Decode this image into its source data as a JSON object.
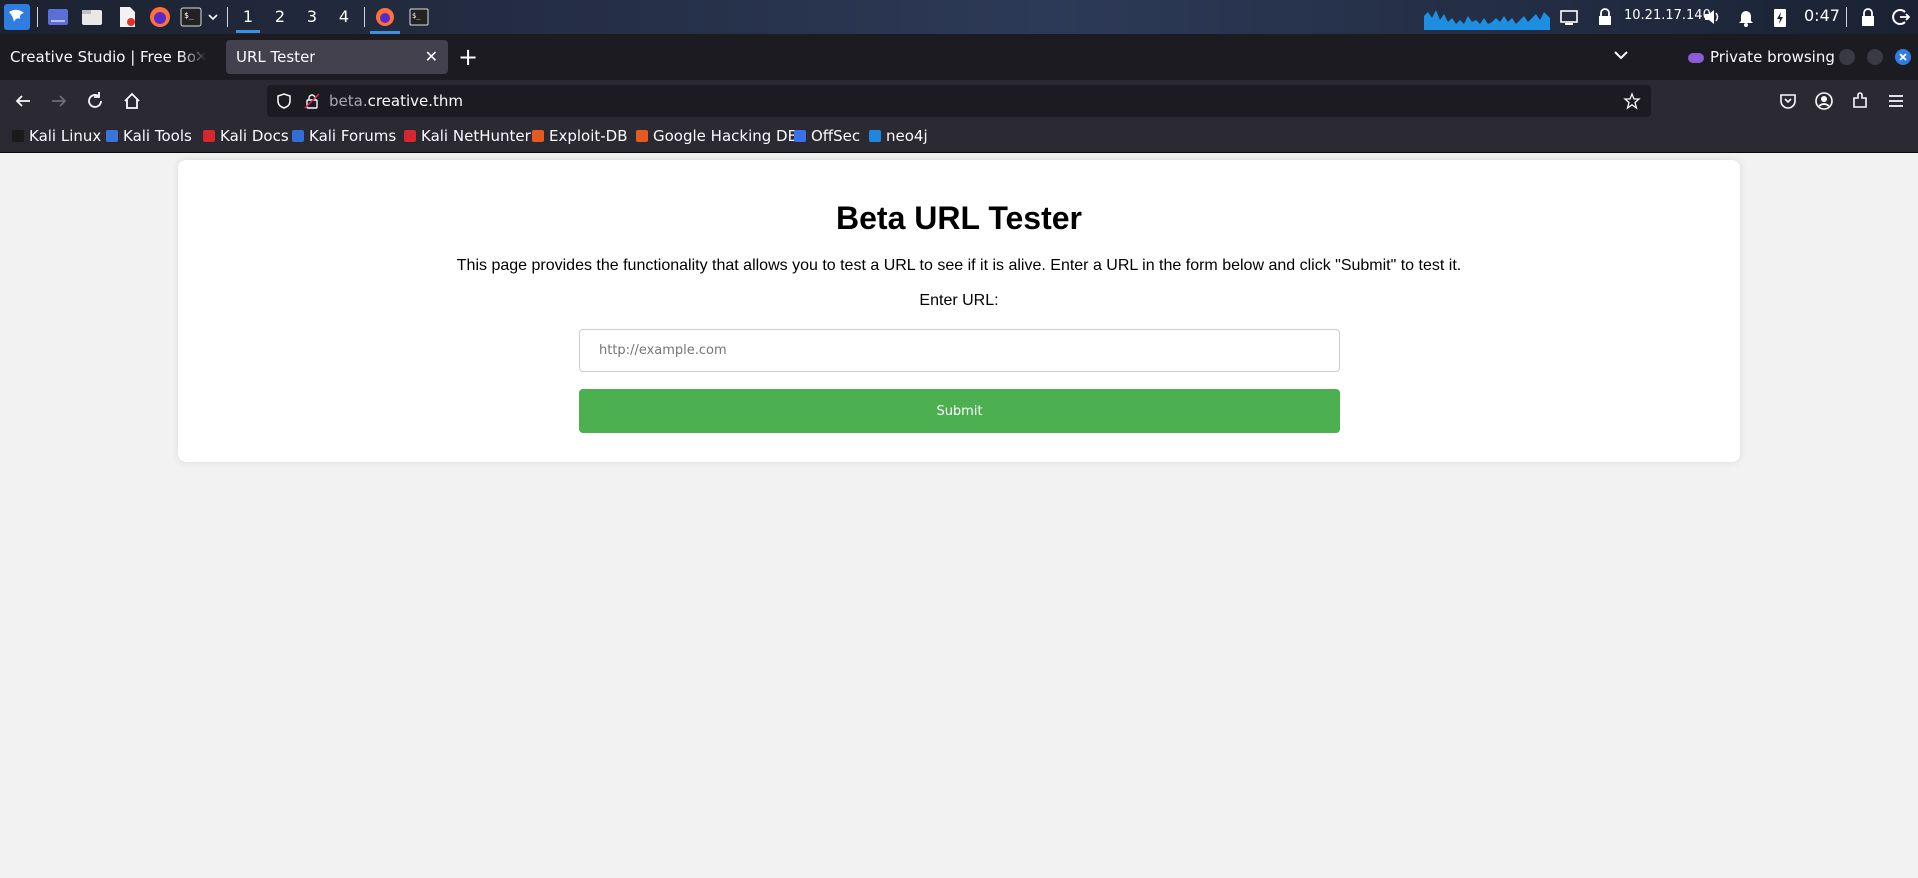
{
  "taskbar": {
    "workspaces": [
      "1",
      "2",
      "3",
      "4"
    ],
    "active_workspace": "1",
    "ip_address": "10.21.17.140",
    "clock": "0:47"
  },
  "browser": {
    "tabs": [
      {
        "title": "Creative Studio | Free Bootstrap",
        "close": "✕"
      },
      {
        "title": "URL Tester",
        "close": "✕"
      }
    ],
    "new_tab": "+",
    "private_label": "Private browsing",
    "url_domain_prefix": "beta.",
    "url_domain": "creative.thm",
    "bookmarks": [
      {
        "label": "Kali Linux",
        "color": "#1a1a1a"
      },
      {
        "label": "Kali Tools",
        "color": "#3b73d9"
      },
      {
        "label": "Kali Docs",
        "color": "#d8262e"
      },
      {
        "label": "Kali Forums",
        "color": "#2f6fd6"
      },
      {
        "label": "Kali NetHunter",
        "color": "#d8262e"
      },
      {
        "label": "Exploit-DB",
        "color": "#e35b22"
      },
      {
        "label": "Google Hacking DB",
        "color": "#e35b22"
      },
      {
        "label": "OffSec",
        "color": "#3d6fe8"
      },
      {
        "label": "neo4j",
        "color": "#1f86e0"
      }
    ]
  },
  "page": {
    "heading": "Beta URL Tester",
    "description": "This page provides the functionality that allows you to test a URL to see if it is alive. Enter a URL in the form below and click \"Submit\" to test it.",
    "url_label": "Enter URL:",
    "url_placeholder": "http://example.com",
    "url_value": "",
    "submit_label": "Submit",
    "submit_color": "#4caf50"
  }
}
